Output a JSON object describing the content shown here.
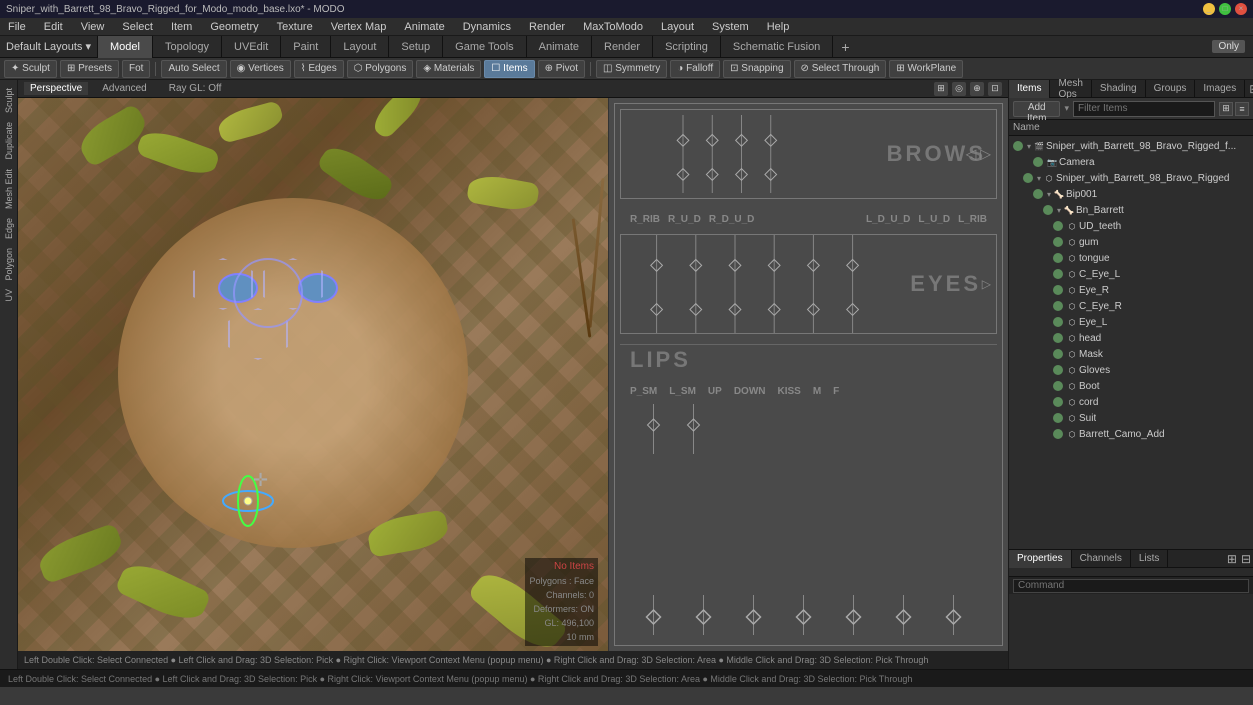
{
  "titlebar": {
    "title": "Sniper_with_Barrett_98_Bravo_Rigged_for_Modo_modo_base.lxo* - MODO"
  },
  "menubar": {
    "items": [
      "File",
      "Edit",
      "View",
      "Select",
      "Item",
      "Geometry",
      "Texture",
      "Vertex Map",
      "Animate",
      "Dynamics",
      "Render",
      "MaxToModo",
      "Layout",
      "System",
      "Help"
    ]
  },
  "layout_selector": {
    "label": "Default Layouts",
    "dropdown": "▾"
  },
  "main_tabs": {
    "tabs": [
      "Model",
      "Topology",
      "UVEdit",
      "Paint",
      "Layout",
      "Setup",
      "Game Tools",
      "Animate",
      "Render",
      "Scripting",
      "Schematic Fusion"
    ],
    "active": "Model",
    "only_badge": "Only"
  },
  "toolbar": {
    "sculpt": "Sculpt",
    "presets": "Presets",
    "ft": "Ft",
    "auto_select": "Auto Select",
    "vertices": "Vertices",
    "edges": "Edges",
    "polygons": "Polygons",
    "materials": "Materials",
    "items": "Items",
    "pivot": "Pivot",
    "symmetry": "Symmetry",
    "falloff": "Falloff",
    "snapping": "Snapping",
    "select_through": "Select Through",
    "workplane": "WorkPlane",
    "items_active": true,
    "polygon_active": false
  },
  "viewport": {
    "mode_tabs": [
      "Perspective",
      "Advanced"
    ],
    "active_mode": "Perspective",
    "ray_gl": "Ray GL: Off",
    "active_tab": "Perspective"
  },
  "uv_panel": {
    "sections": {
      "brows": "BROWS",
      "eyes": "EYES",
      "lips": "LIPS",
      "controls": [
        "R_RIB",
        "R_U_D",
        "R_D_U_D",
        "L_D_U_D",
        "L_U_D",
        "L_RIB"
      ],
      "lip_controls": [
        "P_SM",
        "L_SM",
        "UP",
        "DOWN",
        "KISS",
        "M",
        "F"
      ]
    }
  },
  "left_sidebar": {
    "tools": [
      "Sculpt",
      "Duplicate",
      "Mesh Edit",
      "Edge",
      "Polygon",
      "UV"
    ]
  },
  "items_panel": {
    "title": "Items",
    "tabs": [
      "Items",
      "Mesh Ops",
      "Shading",
      "Groups",
      "Images"
    ],
    "add_item_label": "Add Item",
    "filter_placeholder": "Filter Items",
    "header_col": "Name",
    "tree": [
      {
        "label": "Sniper_with_Barrett_98_Bravo_Rigged_f...",
        "indent": 0,
        "expanded": true,
        "eye": true,
        "type": "scene"
      },
      {
        "label": "Camera",
        "indent": 2,
        "eye": true,
        "type": "camera"
      },
      {
        "label": "Sniper_with_Barrett_98_Bravo_Rigged",
        "indent": 1,
        "expanded": true,
        "eye": true,
        "type": "mesh"
      },
      {
        "label": "Bip001",
        "indent": 2,
        "eye": true,
        "type": "bone"
      },
      {
        "label": "Bn_Barrett",
        "indent": 3,
        "eye": true,
        "type": "bone"
      },
      {
        "label": "UD_teeth",
        "indent": 4,
        "eye": true,
        "type": "mesh"
      },
      {
        "label": "gum",
        "indent": 4,
        "eye": true,
        "type": "mesh"
      },
      {
        "label": "tongue",
        "indent": 4,
        "eye": true,
        "type": "mesh"
      },
      {
        "label": "C_Eye_L",
        "indent": 4,
        "eye": true,
        "type": "mesh"
      },
      {
        "label": "Eye_R",
        "indent": 4,
        "eye": true,
        "type": "mesh"
      },
      {
        "label": "C_Eye_R",
        "indent": 4,
        "eye": true,
        "type": "mesh"
      },
      {
        "label": "Eye_L",
        "indent": 4,
        "eye": true,
        "type": "mesh"
      },
      {
        "label": "head",
        "indent": 4,
        "eye": true,
        "type": "mesh"
      },
      {
        "label": "Mask",
        "indent": 4,
        "eye": true,
        "type": "mesh"
      },
      {
        "label": "Gloves",
        "indent": 4,
        "eye": true,
        "type": "mesh"
      },
      {
        "label": "Boot",
        "indent": 4,
        "eye": true,
        "type": "mesh"
      },
      {
        "label": "cord",
        "indent": 4,
        "eye": true,
        "type": "mesh"
      },
      {
        "label": "Suit",
        "indent": 4,
        "eye": true,
        "type": "mesh"
      },
      {
        "label": "Barrett_Camo_Add",
        "indent": 4,
        "eye": true,
        "type": "mesh"
      }
    ]
  },
  "properties_panel": {
    "tabs": [
      "Properties",
      "Channels",
      "Lists"
    ],
    "active_tab": "Properties",
    "no_items": "No Items",
    "fields": [
      {
        "label": "Polygons:",
        "value": "Face"
      },
      {
        "label": "Channels:",
        "value": "0"
      },
      {
        "label": "Deformers:",
        "value": "ON"
      },
      {
        "label": "GL:",
        "value": "496,100"
      },
      {
        "label": "",
        "value": "10 mm"
      }
    ]
  },
  "command_bar": {
    "placeholder": "Command"
  },
  "status_bar": {
    "text": "Left Double Click: Select Connected ● Left Click and Drag: 3D Selection: Pick ● Right Click: Viewport Context Menu (popup menu) ● Right Click and Drag: 3D Selection: Area ● Middle Click and Drag: 3D Selection: Pick Through"
  }
}
